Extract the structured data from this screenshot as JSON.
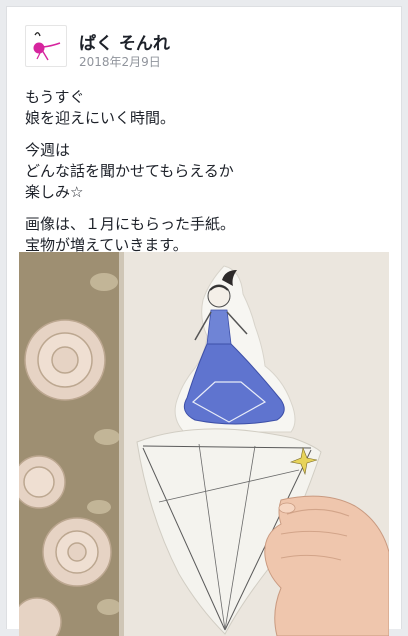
{
  "post": {
    "author": "ぱく そんれ",
    "date": "2018年2月9日",
    "paragraphs": [
      [
        "もうすぐ",
        "娘を迎えにいく時間。"
      ],
      [
        "今週は",
        "どんな話を聞かせてもらえるか",
        "楽しみ☆"
      ],
      [
        "画像は、１月にもらった手紙。",
        "宝物が増えていきます。"
      ]
    ]
  },
  "colors": {
    "avatar_accent": "#d6259e",
    "photo_wall": "#e9e3da",
    "wallpaper": "#9e8f72",
    "drawing_blue": "#4f62c4"
  }
}
